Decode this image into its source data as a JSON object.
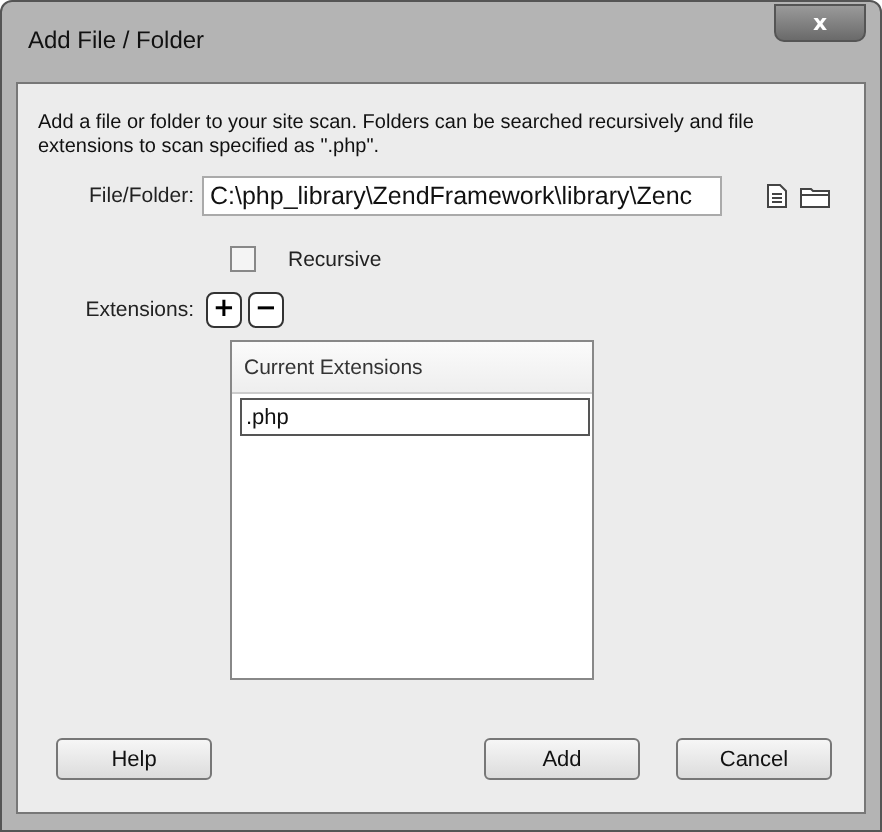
{
  "window": {
    "title": "Add File / Folder",
    "close": "x"
  },
  "description": "Add a file or folder to your site scan. Folders can be searched recursively and file extensions to scan specified as \".php\".",
  "file_folder": {
    "label": "File/Folder:",
    "value": "C:\\php_library\\ZendFramework\\library\\Zenc"
  },
  "recursive": {
    "label": "Recursive",
    "checked": false
  },
  "extensions": {
    "label": "Extensions:",
    "add": "+",
    "remove": "−",
    "header": "Current Extensions",
    "items": [
      {
        "value": ".php",
        "selected": true
      }
    ]
  },
  "buttons": [
    {
      "label": "Help",
      "kind": "left"
    },
    {
      "label": "Add",
      "kind": "right"
    },
    {
      "label": "Cancel",
      "kind": "right"
    }
  ]
}
